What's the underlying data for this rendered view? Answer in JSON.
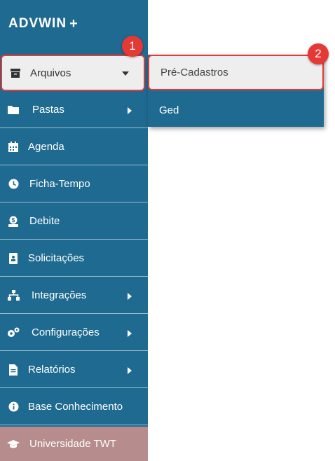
{
  "logo": {
    "text": "ADVWIN",
    "mark": "+"
  },
  "sidebar": {
    "items": [
      {
        "label": "Arquivos",
        "icon": "archive-icon"
      },
      {
        "label": "Pastas",
        "icon": "folder-icon"
      },
      {
        "label": "Agenda",
        "icon": "calendar-icon"
      },
      {
        "label": "Ficha-Tempo",
        "icon": "clock-icon"
      },
      {
        "label": "Debite",
        "icon": "debit-icon"
      },
      {
        "label": "Solicitações",
        "icon": "id-badge-icon"
      },
      {
        "label": "Integrações",
        "icon": "network-icon"
      },
      {
        "label": "Configurações",
        "icon": "cogs-icon"
      },
      {
        "label": "Relatórios",
        "icon": "file-icon"
      },
      {
        "label": "Base Conhecimento",
        "icon": "info-icon"
      },
      {
        "label": "Universidade TWT",
        "icon": "graduation-cap-icon"
      }
    ]
  },
  "submenu": {
    "items": [
      {
        "label": "Pré-Cadastros"
      },
      {
        "label": "Ged"
      }
    ]
  },
  "callouts": [
    "1",
    "2"
  ],
  "colors": {
    "sidebar": "#1f6a91",
    "highlight": "#e53935",
    "active_bg": "#eeeeee",
    "university_bg": "#b68c8c"
  }
}
